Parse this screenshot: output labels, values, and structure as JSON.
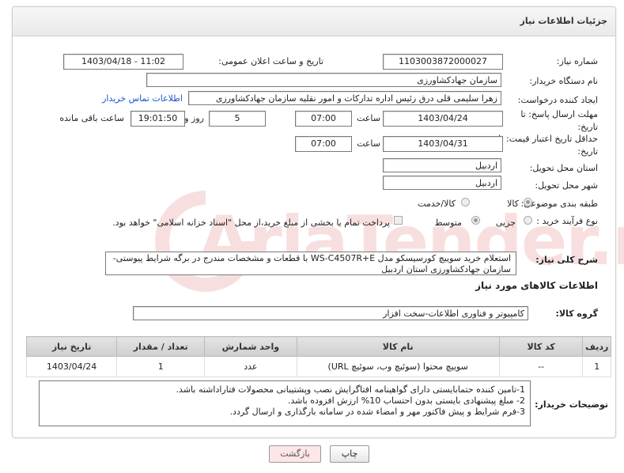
{
  "header": {
    "title": "جزئیات اطلاعات نیاز"
  },
  "fields": {
    "need_number_label": "شماره نیاز:",
    "need_number": "1103003872000027",
    "announce_label": "تاریخ و ساعت اعلان عمومی:",
    "announce_value": "1403/04/18 - 11:02",
    "buyer_org_label": "نام دستگاه خریدار:",
    "buyer_org": "سازمان جهادکشاورزی",
    "creator_label": "ایجاد کننده درخواست:",
    "creator": "زهرا سلیمی قلی درق رئیس اداره تدارکات و امور نقلیه سازمان جهادکشاورزی",
    "contact_link": "اطلاعات تماس خریدار",
    "deadline_label": "مهلت ارسال پاسخ: تا تاریخ:",
    "deadline_date": "1403/04/24",
    "time_label": "ساعت",
    "deadline_time": "07:00",
    "days_value": "5",
    "days_label": "روز و",
    "remaining_time": "19:01:50",
    "remaining_label": "ساعت باقی مانده",
    "validity_label": "حداقل تاریخ اعتبار قیمت: تا تاریخ:",
    "validity_date": "1403/04/31",
    "validity_time_label": "ساعت",
    "validity_time": "07:00",
    "province_label": "استان محل تحویل:",
    "province": "اردبیل",
    "city_label": "شهر محل تحویل:",
    "city": "اردبیل",
    "category_label": "طبقه بندی موضوعی:",
    "category_options": [
      "کالا",
      "کالا/خدمت"
    ],
    "process_label": "نوع فرآیند خرید :",
    "process_options": [
      "جزیی",
      "متوسط"
    ],
    "payment_note": "پرداخت تمام یا بخشی از مبلغ خرید،از محل \"اسناد خزانه اسلامی\" خواهد بود."
  },
  "description": {
    "label": "شرح کلی نیاز:",
    "text": "استعلام خرید سوییچ کورسیسکو مدل WS-C4507R+E با قطعات و مشخصات مندرج در برگه شرایط پیوستی-سازمان جهادکشاورزی استان اردبیل"
  },
  "goods_info": {
    "section_title": "اطلاعات کالاهای مورد نیاز",
    "group_label": "گروه کالا:",
    "group_value": "کامپیوتر و فناوری اطلاعات-سخت افزار"
  },
  "table": {
    "headers": [
      "ردیف",
      "کد کالا",
      "نام کالا",
      "واحد شمارش",
      "تعداد / مقدار",
      "تاریخ نیاز"
    ],
    "rows": [
      [
        "1",
        "--",
        "سوییچ محتوا (سوئیچ وب، سوئیچ URL)",
        "عدد",
        "1",
        "1403/04/24"
      ]
    ]
  },
  "notes": {
    "label": "توضیحات خریدار:",
    "lines": [
      "1-تامین کننده حتمابایستی دارای گواهینامه افتاگرایش نصب وپشتیبانی محصولات فتاراداشته باشد.",
      "2- مبلغ پیشنهادی بایستی بدون احتساب 10% ارزش افزوده باشد.",
      "3-فرم شرایط و پیش فاکتور مهر و امضاء شده در سامانه بارگذاری و ارسال گردد."
    ]
  },
  "buttons": {
    "print": "چاپ",
    "back": "بازگشت"
  },
  "watermark": {
    "text": "AriaTender.neT"
  },
  "colors": {
    "link": "#1a55c8",
    "back_button": "#fce6e6"
  }
}
